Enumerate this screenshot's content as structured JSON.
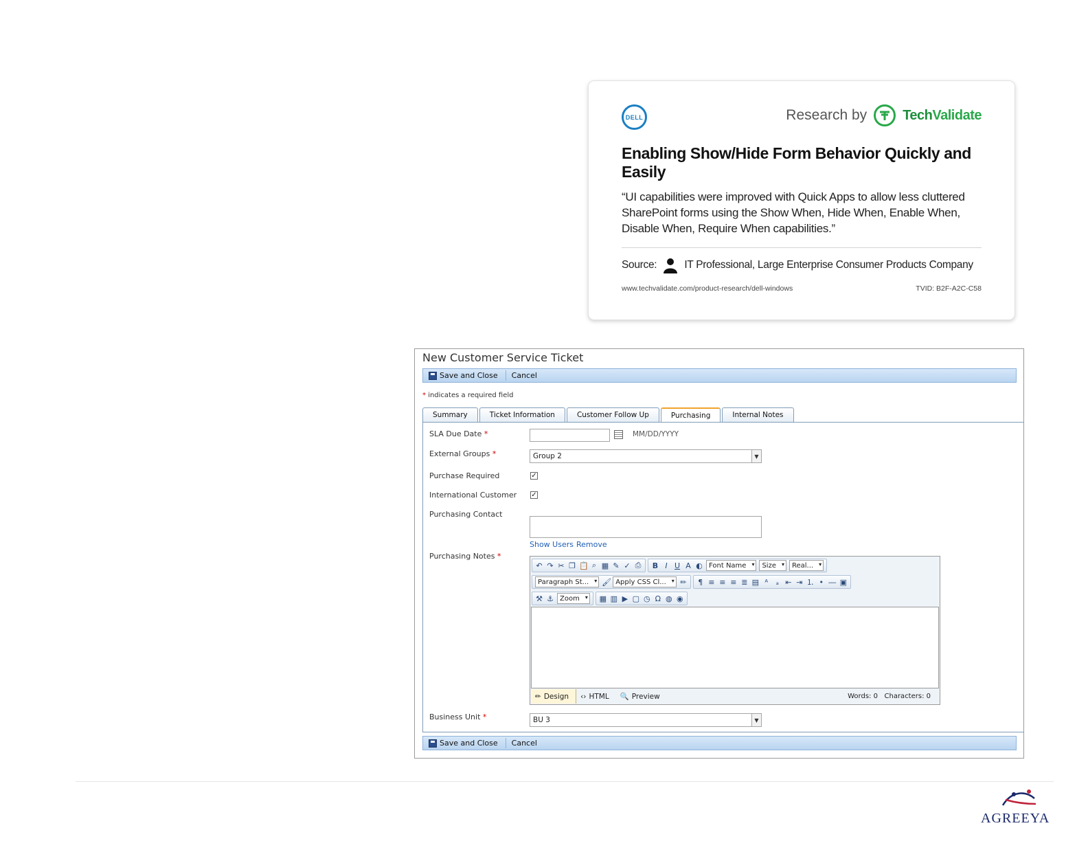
{
  "tv_card": {
    "dell_logo_text": "DELL",
    "research_by": "Research by",
    "brand_prefix": "Tech",
    "brand_suffix": "Validate",
    "title": "Enabling Show/Hide Form Behavior Quickly and Easily",
    "quote": "“UI capabilities were improved with Quick Apps to allow less cluttered SharePoint forms using the Show When, Hide When, Enable When, Disable When, Require When capabilities.”",
    "source_label": "Source:",
    "source_text": "IT Professional, Large Enterprise Consumer Products Company",
    "url": "www.techvalidate.com/product-research/dell-windows",
    "tvid": "TVID: B2F-A2C-C58"
  },
  "form": {
    "title": "New Customer Service Ticket",
    "toolbar": {
      "save_close": "Save and Close",
      "cancel": "Cancel"
    },
    "required_note": "indicates a required field",
    "required_star": "*",
    "tabs": [
      {
        "label": "Summary"
      },
      {
        "label": "Ticket Information"
      },
      {
        "label": "Customer Follow Up"
      },
      {
        "label": "Purchasing",
        "active": true
      },
      {
        "label": "Internal Notes"
      }
    ],
    "fields": {
      "sla_due_date": {
        "label": "SLA Due Date",
        "value": "",
        "hint": "MM/DD/YYYY"
      },
      "external_groups": {
        "label": "External Groups",
        "value": "Group 2"
      },
      "purchase_required": {
        "label": "Purchase Required",
        "checked": true,
        "mark": "✓"
      },
      "international_customer": {
        "label": "International Customer",
        "checked": true,
        "mark": "✓"
      },
      "purchasing_contact": {
        "label": "Purchasing Contact",
        "value": "",
        "show_users": "Show Users",
        "remove": "Remove"
      },
      "purchasing_notes": {
        "label": "Purchasing Notes"
      },
      "business_unit": {
        "label": "Business Unit",
        "value": "BU 3"
      }
    },
    "rte": {
      "font_name": "Font Name",
      "size": "Size",
      "real": "Real...",
      "paragraph_style": "Paragraph St...",
      "apply_css": "Apply CSS Cl...",
      "zoom": "Zoom",
      "bold": "B",
      "italic": "I",
      "underline": "U",
      "font_color": "A",
      "mode_design": "Design",
      "mode_html": "HTML",
      "mode_preview": "Preview",
      "words": "Words: 0",
      "characters": "Characters: 0"
    }
  },
  "footer_logo": "AGREEYA",
  "colors": {
    "toolbar_blue": "#b9d4f0",
    "active_tab_accent": "#f0a22b",
    "link_blue": "#1f5fb4",
    "techvalidate_green": "#29a84a",
    "dell_blue": "#1a7fc3",
    "agreeya_navy": "#1b2a6b"
  }
}
